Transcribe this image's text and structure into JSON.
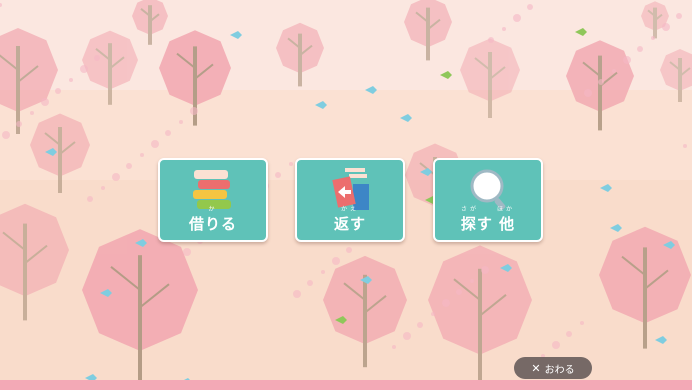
{
  "menu": {
    "borrow": {
      "label": "借りる",
      "ruby": "か"
    },
    "return": {
      "label": "返す",
      "ruby": "かえ"
    },
    "search": {
      "label": "探す 他",
      "ruby": "さが　　ほか"
    }
  },
  "close": {
    "icon": "✕",
    "label": "おわる"
  },
  "colors": {
    "button": "#5fc2b8",
    "background": "#fbe3d6",
    "tree_pink": "#f2a7b0",
    "bird_blue": "#7fcde0"
  }
}
